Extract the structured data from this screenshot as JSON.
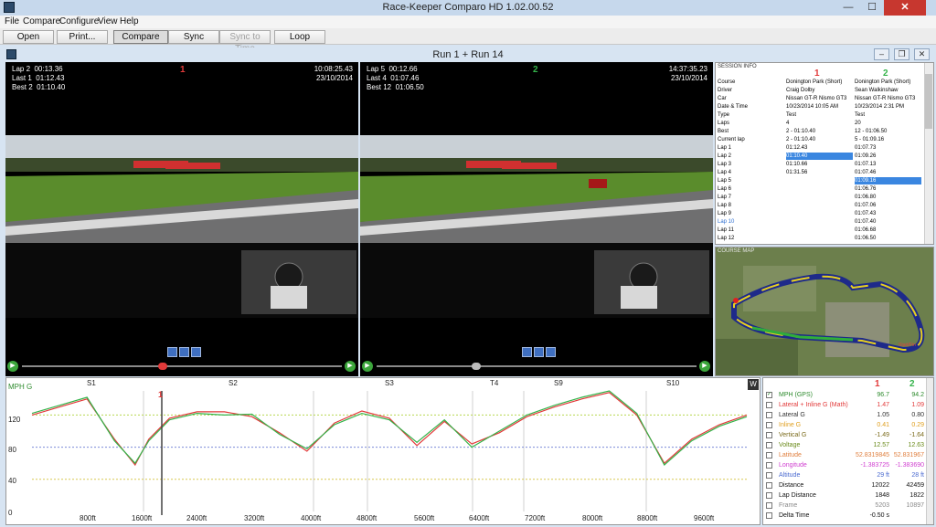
{
  "app": {
    "title": "Race-Keeper Comparo HD 1.02.00.52",
    "window_controls": {
      "minimize": "—",
      "maximize": "☐",
      "close": "✕"
    }
  },
  "menu": [
    "File",
    "Compare",
    "Configure",
    "View",
    "Help"
  ],
  "toolbar": {
    "buttons": [
      {
        "label": "Open"
      },
      {
        "label": "Print..."
      },
      {
        "label": "Compare"
      },
      {
        "label": "Sync"
      },
      {
        "label": "Sync to Time"
      },
      {
        "label": "Loop"
      }
    ]
  },
  "comparison": {
    "title": "Run 1 + Run 14"
  },
  "video1": {
    "number": "1",
    "number_color": "#e23a3a",
    "lap": "Lap 2",
    "lap_time": "00:13.36",
    "last": "Last 1",
    "last_time": "01:12.43",
    "best": "Best 2",
    "best_time": "01:10.40",
    "clock": "10:08:25.43",
    "date": "23/10/2014",
    "progress": 0.44
  },
  "video2": {
    "number": "2",
    "number_color": "#34b34a",
    "lap": "Lap 5",
    "lap_time": "00:12.66",
    "last": "Last 4",
    "last_time": "01:07.46",
    "best": "Best 12",
    "best_time": "01:06.50",
    "clock": "14:37:35.23",
    "date": "23/10/2014",
    "progress": 0.31
  },
  "session_info": {
    "title": "SESSION INFO",
    "col1_num": "1",
    "col2_num": "2",
    "rows": [
      {
        "label": "Course",
        "v1": "Donington Park (Short)",
        "v2": "Donington Park (Short)"
      },
      {
        "label": "Driver",
        "v1": "Craig Dolby",
        "v2": "Sean Walkinshaw"
      },
      {
        "label": "Car",
        "v1": "Nissan GT-R Nismo GT3",
        "v2": "Nissan GT-R Nismo GT3"
      },
      {
        "label": "Date & Time",
        "v1": "10/23/2014 10:05 AM",
        "v2": "10/23/2014 2:31 PM"
      },
      {
        "label": "Type",
        "v1": "Test",
        "v2": "Test"
      },
      {
        "label": "Laps",
        "v1": "4",
        "v2": "20"
      },
      {
        "label": "Best",
        "v1": "2 - 01:10.40",
        "v2": "12 - 01:06.50"
      },
      {
        "label": "Current lap",
        "v1": "2 - 01:10.40",
        "v2": "5 - 01:09.16"
      },
      {
        "label": "Lap 1",
        "v1": "01:12.43",
        "v2": "01:07.73"
      },
      {
        "label": "Lap 2",
        "v1": "01:10.40",
        "v2": "01:09.26",
        "sel1": true
      },
      {
        "label": "Lap 3",
        "v1": "01:10.66",
        "v2": "01:07.13"
      },
      {
        "label": "Lap 4",
        "v1": "01:31.56",
        "v2": "01:07.46"
      },
      {
        "label": "Lap 5",
        "v1": "",
        "v2": "01:09.16",
        "sel2": true
      },
      {
        "label": "Lap 6",
        "v1": "",
        "v2": "01:06.76"
      },
      {
        "label": "Lap 7",
        "v1": "",
        "v2": "01:06.80"
      },
      {
        "label": "Lap 8",
        "v1": "",
        "v2": "01:07.06"
      },
      {
        "label": "Lap 9",
        "v1": "",
        "v2": "01:07.43"
      },
      {
        "label": "Lap 10",
        "v1": "",
        "v2": "01:07.40",
        "blue": true
      },
      {
        "label": "Lap 11",
        "v1": "",
        "v2": "01:06.68"
      },
      {
        "label": "Lap 12",
        "v1": "",
        "v2": "01:06.50"
      }
    ]
  },
  "course_map": {
    "title": "COURSE MAP",
    "label": "Start/Fin"
  },
  "graph": {
    "y_title": "MPH G",
    "w_label": "W",
    "sectors": [
      "S1",
      "S2",
      "S3",
      "T4",
      "S9",
      "S10"
    ],
    "y_ticks": [
      "120",
      "80",
      "40",
      "0"
    ],
    "x_ticks": [
      "800ft",
      "1600ft",
      "2400ft",
      "3200ft",
      "4000ft",
      "4800ft",
      "5600ft",
      "6400ft",
      "7200ft",
      "8000ft",
      "8800ft",
      "9600ft"
    ],
    "cursor_label": "1",
    "series1_color": "#e23a3a",
    "series2_color": "#34b34a"
  },
  "chart_data": {
    "type": "line",
    "ylabel": "MPH G",
    "ylim": [
      0,
      150
    ],
    "xlim": [
      0,
      10400
    ],
    "x_ticks": [
      "800ft",
      "1600ft",
      "2400ft",
      "3200ft",
      "4000ft",
      "4800ft",
      "5600ft",
      "6400ft",
      "7200ft",
      "8000ft",
      "8800ft",
      "9600ft"
    ],
    "sectors": [
      "S1",
      "S2",
      "S3",
      "T4",
      "S9",
      "S10"
    ],
    "grid": true,
    "series": [
      {
        "color": "#e23a3a",
        "x": [
          0,
          400,
          800,
          1200,
          1500,
          1700,
          2000,
          2400,
          2800,
          3200,
          3600,
          4000,
          4400,
          4800,
          5200,
          5600,
          6000,
          6400,
          6800,
          7200,
          7600,
          8000,
          8400,
          8800,
          9200,
          9600,
          10000,
          10400
        ],
        "y": [
          120,
          130,
          140,
          90,
          58,
          90,
          116,
          124,
          124,
          118,
          98,
          75,
          110,
          125,
          116,
          82,
          112,
          84,
          98,
          118,
          130,
          140,
          148,
          120,
          60,
          90,
          108,
          120
        ]
      },
      {
        "color": "#34b34a",
        "x": [
          0,
          400,
          800,
          1200,
          1500,
          1700,
          2000,
          2400,
          2800,
          3200,
          3600,
          4000,
          4400,
          4800,
          5200,
          5600,
          6000,
          6400,
          6800,
          7200,
          7600,
          8000,
          8400,
          8800,
          9200,
          9600,
          10000,
          10400
        ],
        "y": [
          122,
          132,
          142,
          88,
          60,
          88,
          114,
          122,
          120,
          121,
          96,
          78,
          108,
          122,
          114,
          86,
          114,
          80,
          100,
          120,
          132,
          142,
          150,
          122,
          58,
          88,
          106,
          118
        ]
      }
    ]
  },
  "channels": {
    "col1_num": "1",
    "col2_num": "2",
    "rows": [
      {
        "name": "MPH (GPS)",
        "v1": "96.7",
        "v2": "94.2",
        "color": "#2e8b2e",
        "checked": true
      },
      {
        "name": "Lateral + Inline G (Math)",
        "v1": "1.47",
        "v2": "1.09",
        "color": "#e23a3a",
        "checked": false
      },
      {
        "name": "Lateral G",
        "v1": "1.05",
        "v2": "0.80",
        "color": "#333333",
        "checked": false
      },
      {
        "name": "Inline G",
        "v1": "0.41",
        "v2": "0.29",
        "color": "#e0a020",
        "checked": false
      },
      {
        "name": "Vertical G",
        "v1": "-1.49",
        "v2": "-1.64",
        "color": "#7a6a1a",
        "checked": false
      },
      {
        "name": "Voltage",
        "v1": "12.57",
        "v2": "12.63",
        "color": "#6a8a1a",
        "checked": false
      },
      {
        "name": "Latitude",
        "v1": "52.8319845",
        "v2": "52.831967",
        "color": "#e08040",
        "checked": false
      },
      {
        "name": "Longitude",
        "v1": "-1.383725",
        "v2": "-1.383690",
        "color": "#d040d0",
        "checked": false
      },
      {
        "name": "Altitude",
        "v1": "29 ft",
        "v2": "28 ft",
        "color": "#4a6ad0",
        "checked": false
      },
      {
        "name": "Distance",
        "v1": "12022",
        "v2": "42459",
        "color": "#111111",
        "checked": false
      },
      {
        "name": "Lap Distance",
        "v1": "1848",
        "v2": "1822",
        "color": "#111111",
        "checked": false
      },
      {
        "name": "Frame",
        "v1": "5203",
        "v2": "10897",
        "color": "#888888",
        "checked": false
      },
      {
        "name": "Delta Time",
        "v1": "-0.50 s",
        "v2": "",
        "color": "#111111",
        "checked": false
      }
    ]
  }
}
